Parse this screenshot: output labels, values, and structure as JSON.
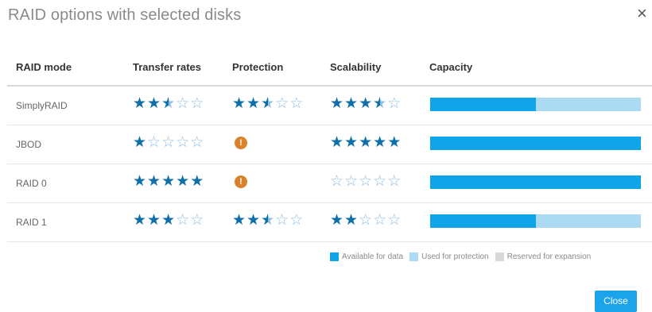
{
  "dialog": {
    "title": "RAID options with selected disks",
    "close_glyph": "×",
    "close_button_label": "Close"
  },
  "table": {
    "headers": {
      "raid_mode": "RAID mode",
      "transfer_rates": "Transfer rates",
      "protection": "Protection",
      "scalability": "Scalability",
      "capacity": "Capacity"
    },
    "rows": [
      {
        "mode": "SimplyRAID",
        "transfer_rates": 2.5,
        "protection": 2.5,
        "scalability": 3.5,
        "protection_warning": false,
        "capacity_available_pct": 50
      },
      {
        "mode": "JBOD",
        "transfer_rates": 1,
        "protection": null,
        "scalability": 5,
        "protection_warning": true,
        "capacity_available_pct": 100
      },
      {
        "mode": "RAID 0",
        "transfer_rates": 5,
        "protection": null,
        "scalability": 0,
        "protection_warning": true,
        "capacity_available_pct": 100
      },
      {
        "mode": "RAID 1",
        "transfer_rates": 3,
        "protection": 2.5,
        "scalability": 2,
        "protection_warning": false,
        "capacity_available_pct": 50
      }
    ]
  },
  "legend": {
    "available": "Available for data",
    "used": "Used for protection",
    "reserved": "Reserved for expansion"
  },
  "colors": {
    "available": "#10a4e8",
    "used": "#aadbf2",
    "reserved": "#d9d9d9",
    "warning": "#d9822b",
    "star": "#0f6fa8"
  }
}
